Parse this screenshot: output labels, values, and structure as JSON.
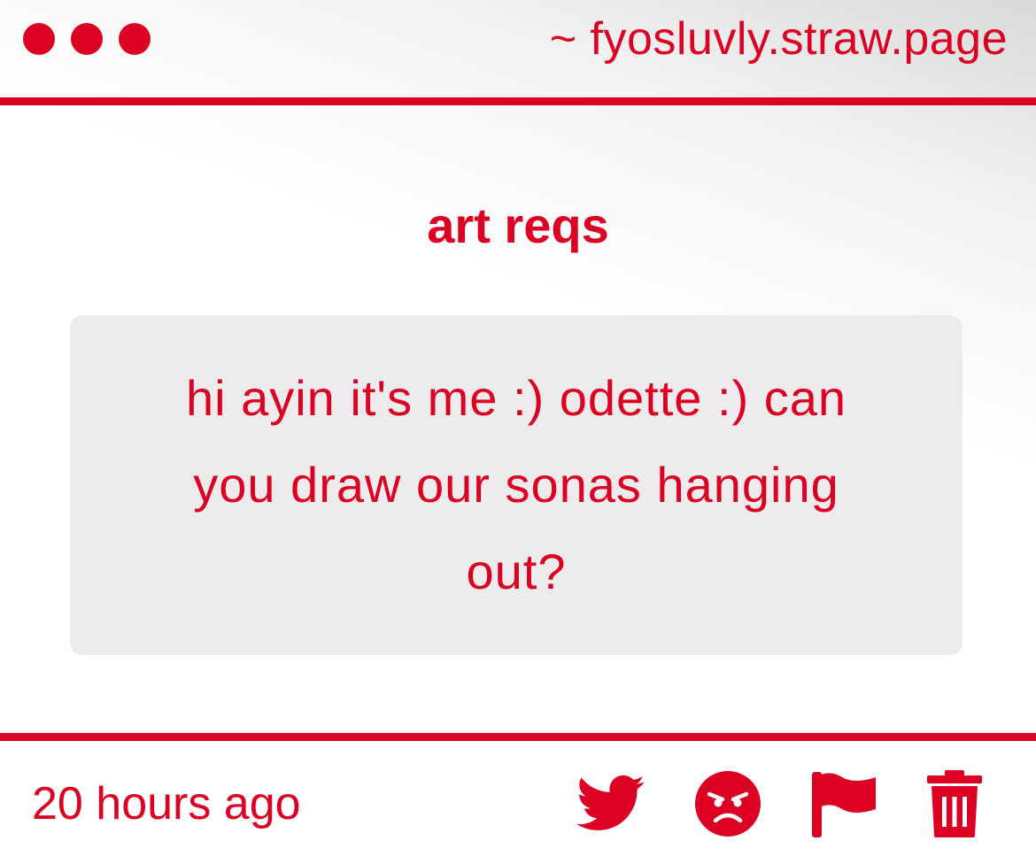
{
  "header": {
    "url": "~ fyosluvly.straw.page"
  },
  "post": {
    "title": "art reqs",
    "message": "hi ayin it's me :) odette :) can you draw our sonas hanging out?",
    "timestamp": "20 hours ago"
  },
  "actions": [
    {
      "icon": "twitter-bird-icon"
    },
    {
      "icon": "angry-face-icon"
    },
    {
      "icon": "flag-icon"
    },
    {
      "icon": "trash-icon"
    }
  ],
  "colors": {
    "accent": "#dc0023",
    "card_background": "#eeebec"
  }
}
